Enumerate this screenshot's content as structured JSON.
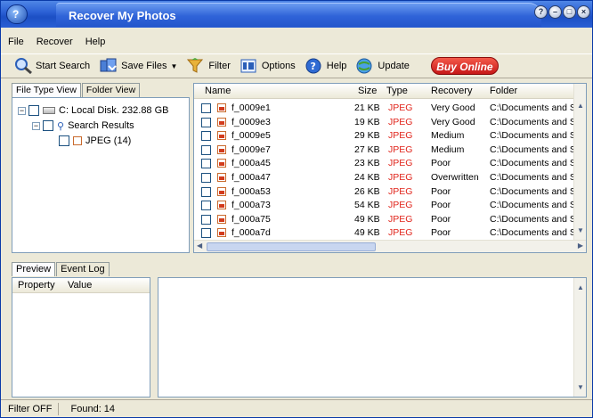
{
  "window": {
    "title": "Recover My Photos"
  },
  "menu": [
    "File",
    "Recover",
    "Help"
  ],
  "toolbar": {
    "start_search": "Start Search",
    "save_files": "Save Files",
    "filter": "Filter",
    "options": "Options",
    "help": "Help",
    "update": "Update",
    "buy_online": "Buy Online"
  },
  "left_tabs": {
    "file_type_view": "File Type View",
    "folder_view": "Folder View"
  },
  "tree": {
    "drive": "C: Local Disk. 232.88 GB",
    "search_results": "Search Results",
    "jpeg_node": "JPEG (14)"
  },
  "list": {
    "columns": {
      "name": "Name",
      "size": "Size",
      "type": "Type",
      "recovery": "Recovery",
      "folder": "Folder"
    },
    "rows": [
      {
        "name": "f_0009e1",
        "size": "21 KB",
        "type": "JPEG",
        "recovery": "Very Good",
        "folder": "C:\\Documents and Se"
      },
      {
        "name": "f_0009e3",
        "size": "19 KB",
        "type": "JPEG",
        "recovery": "Very Good",
        "folder": "C:\\Documents and Se"
      },
      {
        "name": "f_0009e5",
        "size": "29 KB",
        "type": "JPEG",
        "recovery": "Medium",
        "folder": "C:\\Documents and Se"
      },
      {
        "name": "f_0009e7",
        "size": "27 KB",
        "type": "JPEG",
        "recovery": "Medium",
        "folder": "C:\\Documents and Se"
      },
      {
        "name": "f_000a45",
        "size": "23 KB",
        "type": "JPEG",
        "recovery": "Poor",
        "folder": "C:\\Documents and Se"
      },
      {
        "name": "f_000a47",
        "size": "24 KB",
        "type": "JPEG",
        "recovery": "Overwritten",
        "folder": "C:\\Documents and Se"
      },
      {
        "name": "f_000a53",
        "size": "26 KB",
        "type": "JPEG",
        "recovery": "Poor",
        "folder": "C:\\Documents and Se"
      },
      {
        "name": "f_000a73",
        "size": "54 KB",
        "type": "JPEG",
        "recovery": "Poor",
        "folder": "C:\\Documents and Se"
      },
      {
        "name": "f_000a75",
        "size": "49 KB",
        "type": "JPEG",
        "recovery": "Poor",
        "folder": "C:\\Documents and Se"
      },
      {
        "name": "f_000a7d",
        "size": "49 KB",
        "type": "JPEG",
        "recovery": "Poor",
        "folder": "C:\\Documents and Se"
      }
    ]
  },
  "bottom_tabs": {
    "preview": "Preview",
    "event_log": "Event Log"
  },
  "properties": {
    "col_property": "Property",
    "col_value": "Value"
  },
  "status": {
    "filter": "Filter OFF",
    "found": "Found: 14"
  },
  "colors": {
    "jpeg_text": "#e0241b",
    "buy_online_bg": "#d42020",
    "title_bar": "#2d62d6"
  }
}
